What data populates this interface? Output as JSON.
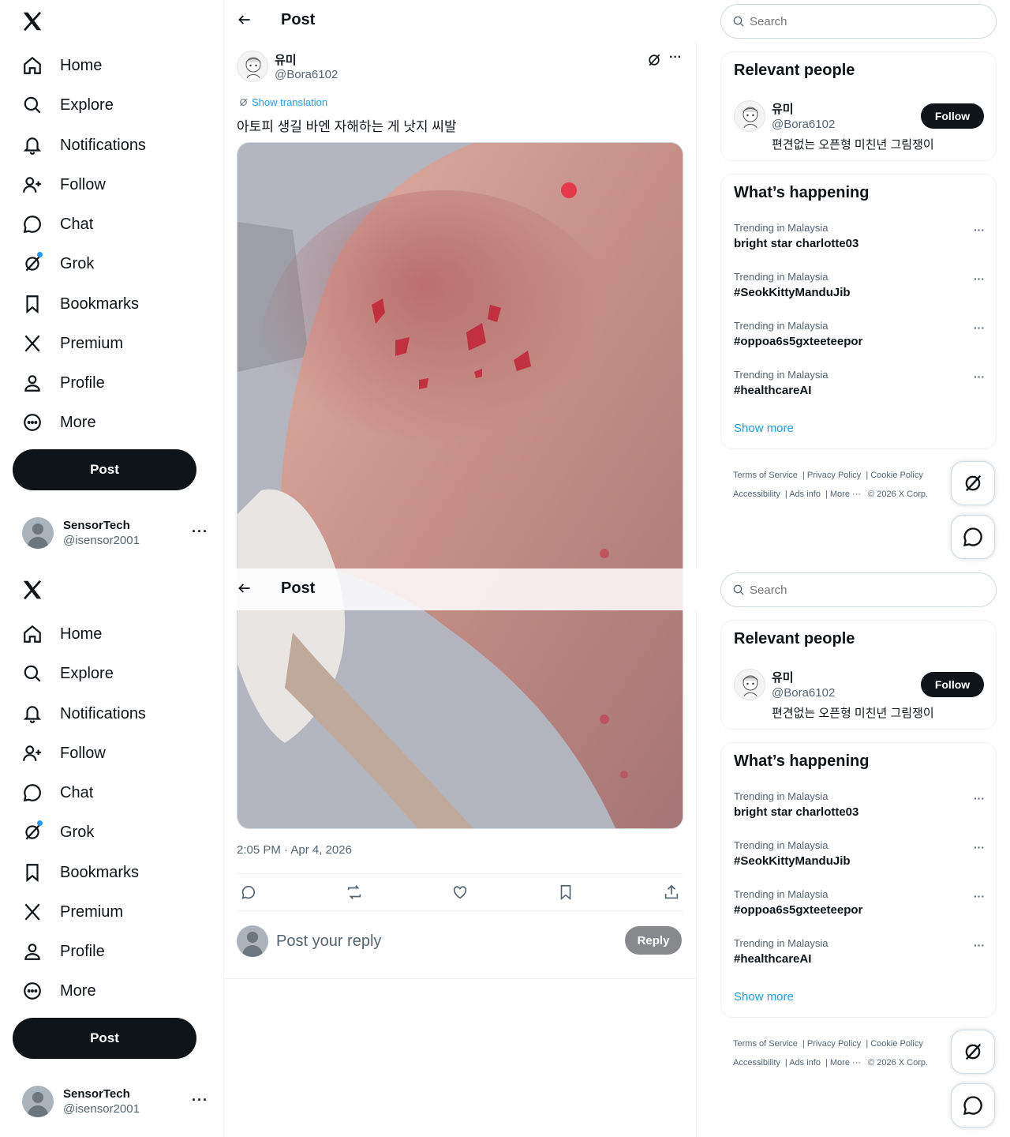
{
  "nav": {
    "items": [
      {
        "label": "Home",
        "icon": "home-icon"
      },
      {
        "label": "Explore",
        "icon": "search-icon"
      },
      {
        "label": "Notifications",
        "icon": "bell-icon"
      },
      {
        "label": "Follow",
        "icon": "add-user-icon"
      },
      {
        "label": "Chat",
        "icon": "chat-icon"
      },
      {
        "label": "Grok",
        "icon": "grok-icon"
      },
      {
        "label": "Bookmarks",
        "icon": "bookmark-icon"
      },
      {
        "label": "Premium",
        "icon": "x-logo-icon"
      },
      {
        "label": "Profile",
        "icon": "person-icon"
      },
      {
        "label": "More",
        "icon": "more-circle-icon"
      }
    ],
    "post_label": "Post"
  },
  "account": {
    "name": "SensorTech",
    "handle": "@isensor2001",
    "more": "···"
  },
  "main": {
    "title": "Post",
    "author": {
      "name": "유미",
      "handle": "@Bora6102"
    },
    "more": "···",
    "translate_label": "Show translation",
    "text": "아토피 생길 바엔 자해하는 게 낫지 씨발",
    "timestamp": "2:05 PM · Apr 4, 2026",
    "reply_placeholder": "Post your reply",
    "reply_label": "Reply"
  },
  "right": {
    "search_placeholder": "Search",
    "people": {
      "title": "Relevant people",
      "name": "유미",
      "handle": "@Bora6102",
      "bio": "편견없는 오픈형 미친년 그림쟁이",
      "follow_label": "Follow"
    },
    "trends": {
      "title": "What’s happening",
      "items": [
        {
          "meta": "Trending in Malaysia",
          "name": "bright star charlotte03"
        },
        {
          "meta": "Trending in Malaysia",
          "name": "#SeokKittyManduJib"
        },
        {
          "meta": "Trending in Malaysia",
          "name": "#oppoa6s5gxteeteepor"
        },
        {
          "meta": "Trending in Malaysia",
          "name": "#healthcareAI"
        }
      ],
      "more_glyph": "···",
      "show_more": "Show more"
    },
    "footer": {
      "terms": "Terms of Service",
      "privacy": "Privacy Policy",
      "cookie": "Cookie Policy",
      "accessibility": "Accessibility",
      "ads": "Ads info",
      "more": "More ···",
      "copyright": "© 2026 X Corp."
    }
  },
  "colors": {
    "accent": "#1d9bf0",
    "text": "#0f1419",
    "muted": "#536471",
    "border": "#eff3f4"
  }
}
